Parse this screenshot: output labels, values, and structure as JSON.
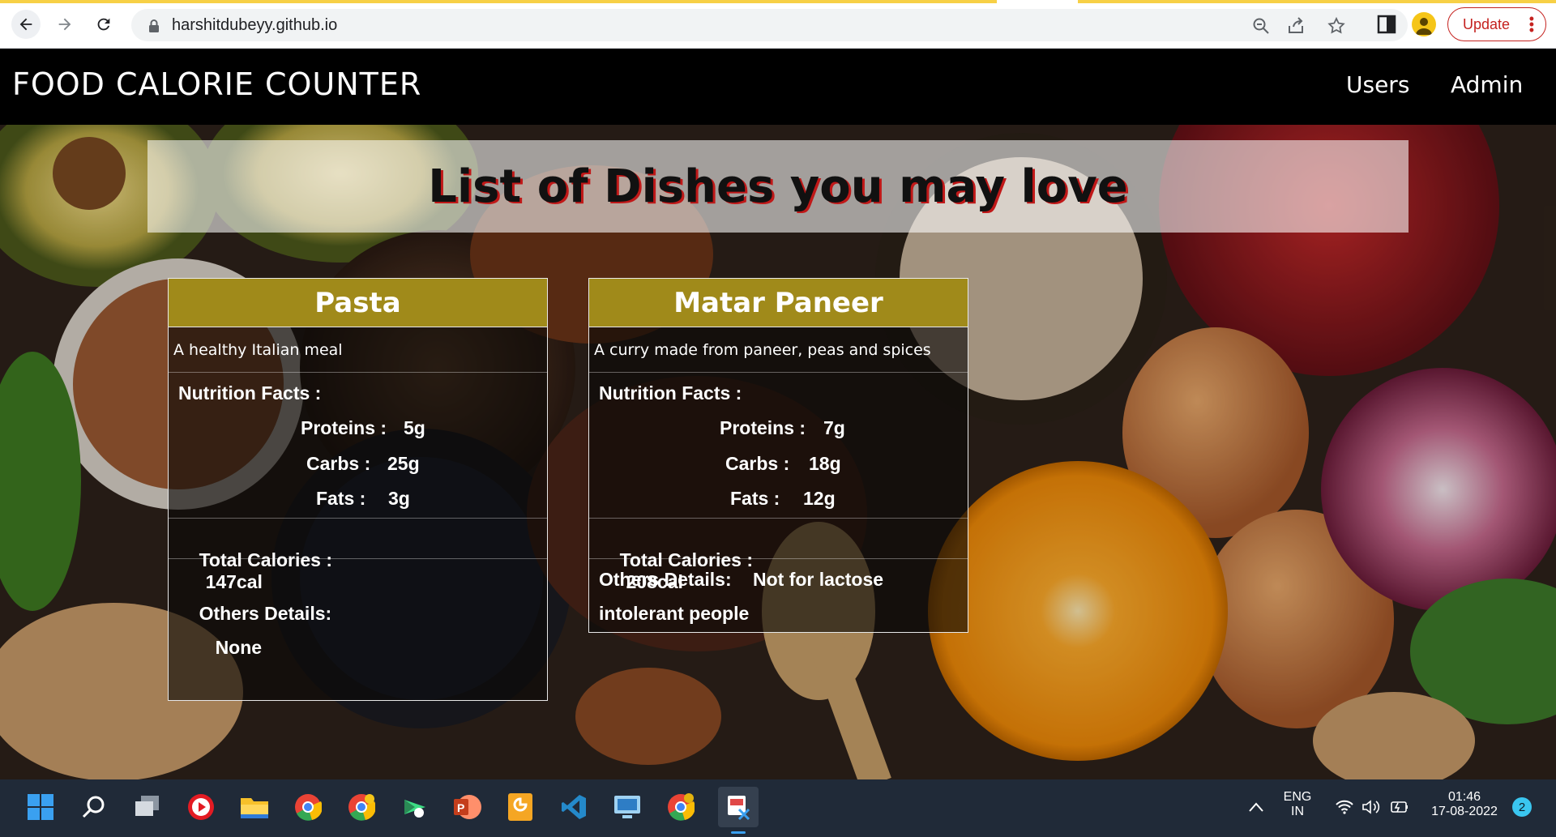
{
  "browser": {
    "url": "harshitdubeyy.github.io",
    "update_label": "Update"
  },
  "site": {
    "title": "FOOD CALORIE COUNTER",
    "nav": [
      "Users",
      "Admin"
    ]
  },
  "banner": {
    "title": "List of Dishes you may love"
  },
  "dishes": [
    {
      "name": "Pasta",
      "description": "A healthy Italian meal",
      "nutrition_title": "Nutrition Facts :",
      "proteins_label": "Proteins :",
      "proteins": "5g",
      "carbs_label": "Carbs :",
      "carbs": "25g",
      "fats_label": "Fats :",
      "fats": "3g",
      "calories_label": "Total Calories :",
      "calories": "147cal",
      "others_label": "Others Details:",
      "others": "None"
    },
    {
      "name": "Matar Paneer",
      "description": "A curry made from paneer, peas and spices",
      "nutrition_title": "Nutrition Facts :",
      "proteins_label": "Proteins :",
      "proteins": "7g",
      "carbs_label": "Carbs :",
      "carbs": "18g",
      "fats_label": "Fats :",
      "fats": "12g",
      "calories_label": "Total Calories :",
      "calories": "208cal",
      "others_label": "Others Details:",
      "others": "Not for lactose intolerant people"
    }
  ],
  "taskbar": {
    "language_line1": "ENG",
    "language_line2": "IN",
    "time": "01:46",
    "date": "17-08-2022",
    "notification_count": "2"
  },
  "colors": {
    "card_header": "#a08a1a",
    "banner_text_shadow": "#c01818",
    "update_red": "#c5221f",
    "taskbar": "#202a38"
  }
}
